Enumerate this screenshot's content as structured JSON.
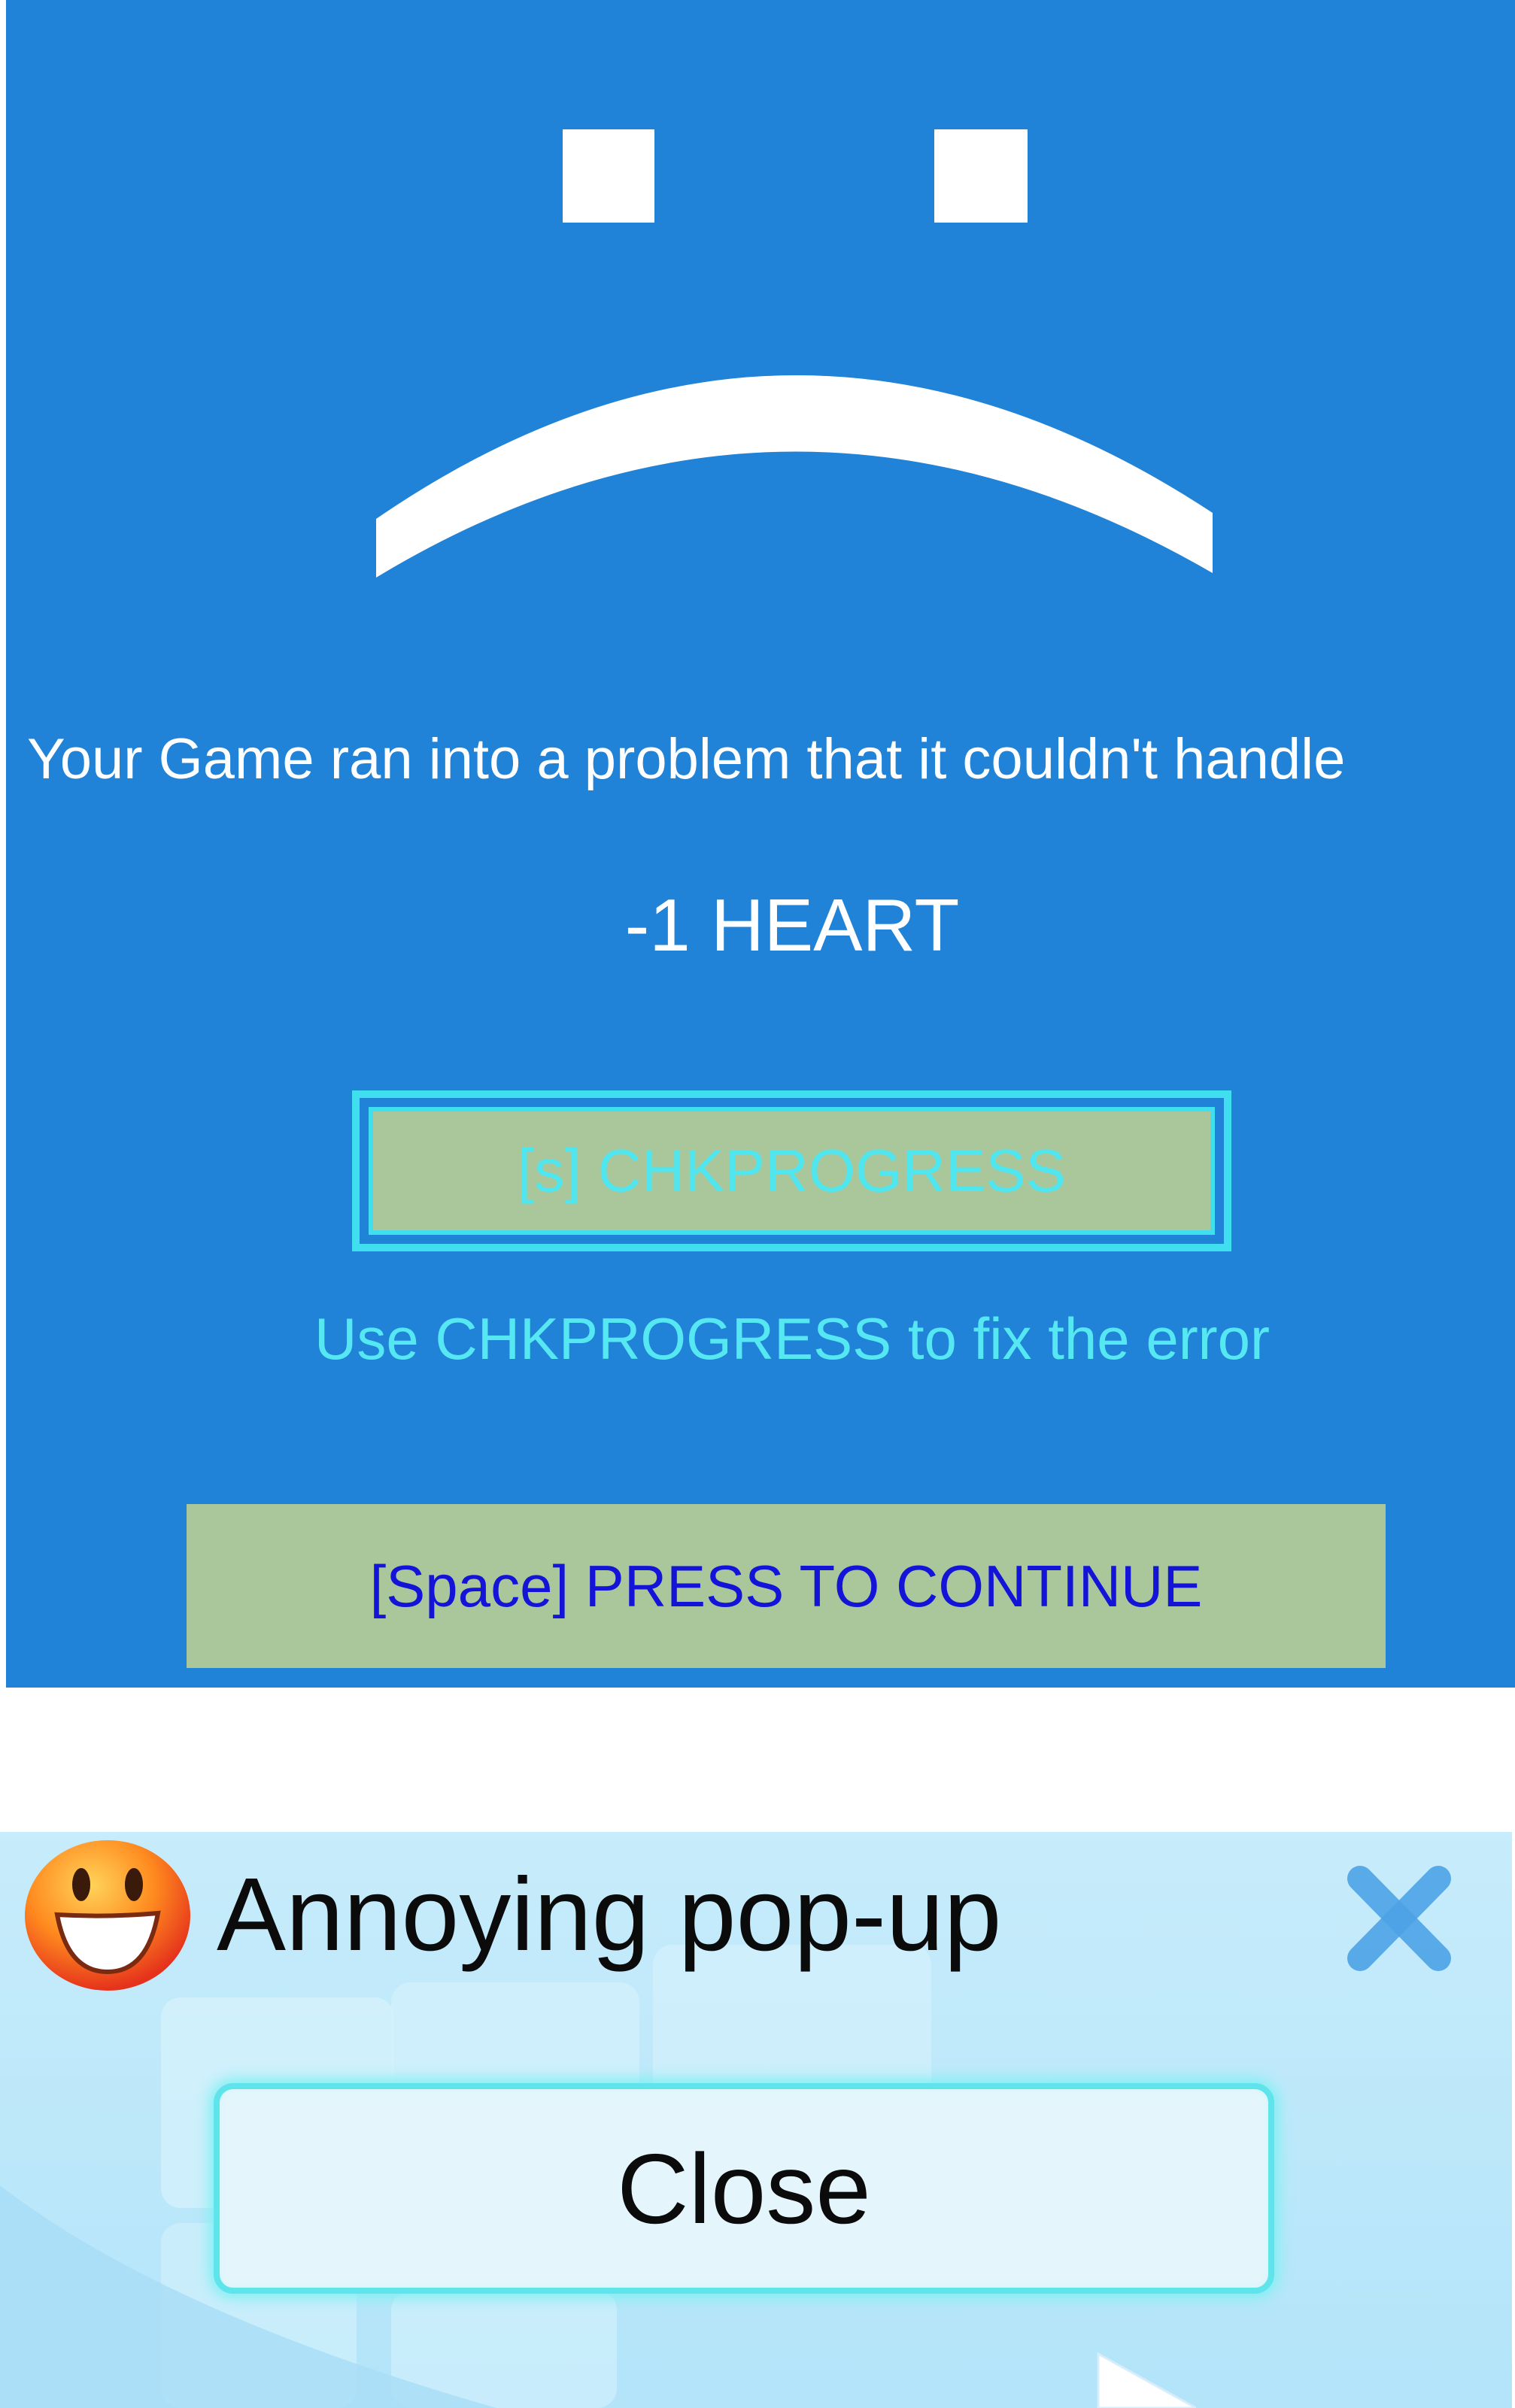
{
  "error_screen": {
    "message": "Your Game ran into a problem that it couldn't handle",
    "penalty": "-1 HEART",
    "chk_button_label": "[s] CHKPROGRESS",
    "hint": "Use CHKPROGRESS to fix the error",
    "continue_label": "[Space] PRESS TO CONTINUE",
    "colors": {
      "background": "#2083d8",
      "button_fill": "#a9c79a",
      "accent_cyan": "#3fdfef",
      "continue_text": "#1414d8"
    }
  },
  "popup": {
    "title": "Annoying pop-up",
    "close_label": "Close",
    "icons": {
      "title_icon": "smiley-face-icon",
      "dismiss_icon": "close-x-icon",
      "pointer": "cursor-arrow-icon"
    }
  }
}
